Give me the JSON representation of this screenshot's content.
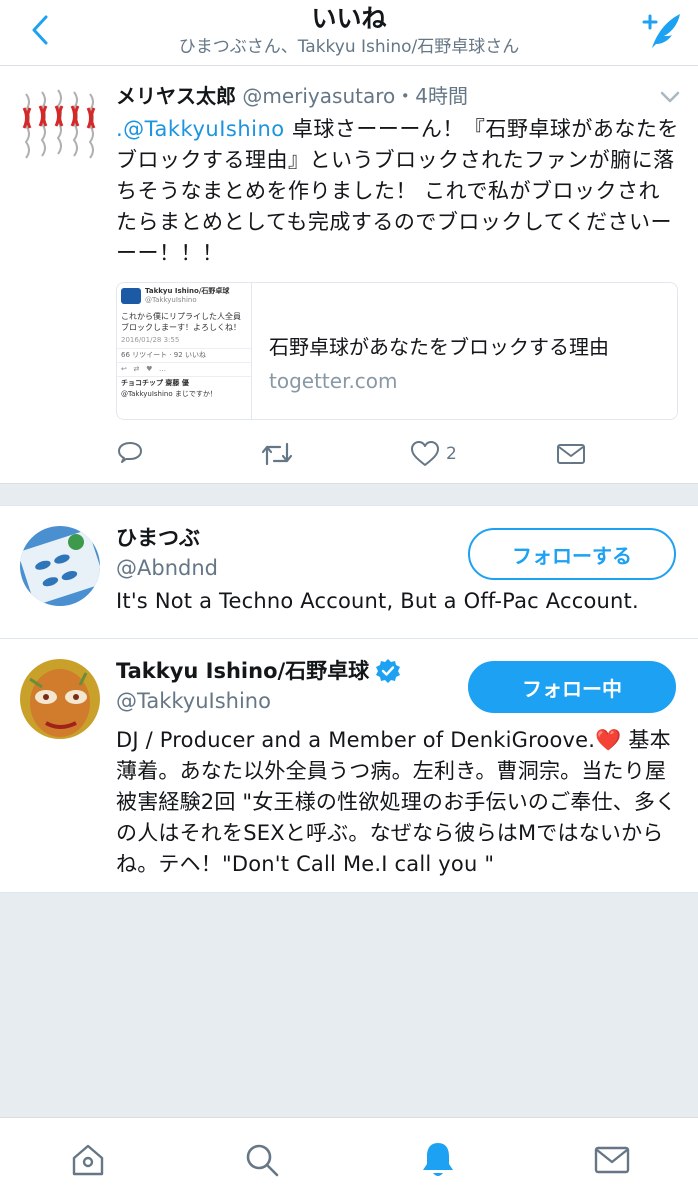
{
  "header": {
    "title": "いいね",
    "subtitle": "ひまつぶさん、Takkyu Ishino/石野卓球さん",
    "back_icon": "chevron-left-icon",
    "compose_icon": "compose-feather-icon"
  },
  "tweet": {
    "author_name": "メリヤス太郎",
    "author_handle": "@meriyasutaro",
    "time": "・4時間",
    "text_mention": ".@TakkyuIshino",
    "text_body": " 卓球さーーーん！『石野卓球があなたをブロックする理由』というブロックされたファンが腑に落ちそうなまとめを作りました！ これで私がブロックされたらまとめとしても完成するのでブロックしてくださいーーー！！！",
    "card": {
      "title": "石野卓球があなたをブロックする理由",
      "domain": "togetter.com",
      "thumb": {
        "name": "Takkyu Ishino/石野卓球",
        "handle": "@TakkyuIshino",
        "text": "これから僕にリプライした人全員ブロックしまーす！よろしくね！",
        "date": "2016/01/28 3:55",
        "stats": "66 リツイート · 92 いいね",
        "reply_name": "チョコチップ 齋藤 優",
        "reply_text": "@TakkyuIshino まじですか！"
      }
    },
    "actions": {
      "reply_icon": "reply-icon",
      "retweet_icon": "retweet-icon",
      "like_icon": "heart-icon",
      "like_count": "2",
      "dm_icon": "envelope-icon"
    }
  },
  "users": [
    {
      "name": "ひまつぶ",
      "handle": "@Abndnd",
      "bio": "It's Not a Techno Account, But a Off-Pac Account.",
      "button": "フォローする"
    },
    {
      "name": "Takkyu Ishino/石野卓球",
      "handle": "@TakkyuIshino",
      "verified_icon": "verified-badge-icon",
      "bio": "DJ / Producer and a Member of DenkiGroove.❤️ 基本薄着。あなた以外全員うつ病。左利き。曹洞宗。当たり屋被害経験2回 \"女王様の性欲処理のお手伝いのご奉仕、多くの人はそれをSEXと呼ぶ。なぜなら彼らはMではないからね。テヘ！\"Don't Call Me.I call you \"",
      "button": "フォロー中"
    }
  ],
  "tabbar": {
    "items": [
      "home-icon",
      "search-icon",
      "notifications-bell-icon",
      "messages-envelope-icon"
    ],
    "active": "notifications-bell-icon"
  },
  "colors": {
    "accent": "#1da1f2",
    "secondary_text": "#657786",
    "background": "#e6ecf0"
  }
}
